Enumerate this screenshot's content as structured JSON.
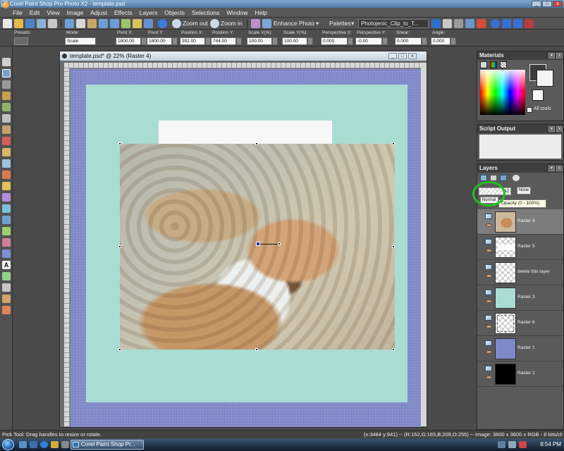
{
  "app": {
    "title": "Corel Paint Shop Pro Photo X2 - template.psd"
  },
  "menu": [
    "File",
    "Edit",
    "View",
    "Image",
    "Adjust",
    "Effects",
    "Layers",
    "Objects",
    "Selections",
    "Window",
    "Help"
  ],
  "toolbar": {
    "zoom_out": "Zoom out",
    "zoom_in": "Zoom in",
    "enhance_photo": "Enhance Photo",
    "palettes": "Palettes",
    "layer_dropdown": "Photojenic_Clip_to_T..."
  },
  "options": {
    "presets_label": "Presets:",
    "mode_label": "Mode:",
    "mode_value": "Scale",
    "pivot_x_label": "Pivot X:",
    "pivot_x": "1800.00",
    "pivot_y_label": "Pivot Y:",
    "pivot_y": "1800.00",
    "position_x_label": "Position X:",
    "position_x": "392.00",
    "position_y_label": "Position Y:",
    "position_y": "744.00",
    "scale_x_label": "Scale X(%):",
    "scale_x": "100.00",
    "scale_y_label": "Scale Y(%):",
    "scale_y": "100.00",
    "persp_x_label": "Perspective X:",
    "persp_x": "0.000",
    "persp_y_label": "Perspective Y:",
    "persp_y": "-0.00",
    "shear_label": "Shear:",
    "shear": "0.000",
    "angle_label": "Angle:",
    "angle": "0.000"
  },
  "document": {
    "title": "template.psd* @  22% (Raster 4)"
  },
  "panels": {
    "materials": "Materials",
    "all_tools": "All tools",
    "script_output": "Script Output",
    "layers": "Layers",
    "opacity_value": "62",
    "blend_none": "None",
    "blend_normal": "Normal",
    "tooltip": "Opacity (0 - 100%)"
  },
  "layers": [
    {
      "name": "Raster 4",
      "selected": true,
      "thumb": "photo"
    },
    {
      "name": "Raster 5",
      "selected": false,
      "thumb": "checker-white"
    },
    {
      "name": "delete this layer",
      "selected": false,
      "thumb": "checker"
    },
    {
      "name": "Raster 3",
      "selected": false,
      "thumb": "mint"
    },
    {
      "name": "Raster 6",
      "selected": false,
      "thumb": "checker-frame"
    },
    {
      "name": "Raster 1",
      "selected": false,
      "thumb": "periwinkle"
    },
    {
      "name": "Raster 2",
      "selected": false,
      "thumb": "black"
    }
  ],
  "status": {
    "hint": "Pick Tool: Drag handles to resize or rotate.",
    "coords": "(x:3484 y:941) -- (R:152,G:165,B:209,O:255) -- Image:  3600 x 3600 x RGB - 8 bits/channel"
  },
  "taskbar": {
    "app": "Corel Paint Shop Pr...",
    "clock": "8:54 PM"
  },
  "colors": {
    "accent_ring": "#22c11e",
    "paper": "#a9ddd4",
    "border_blue": "#7f88c8"
  }
}
